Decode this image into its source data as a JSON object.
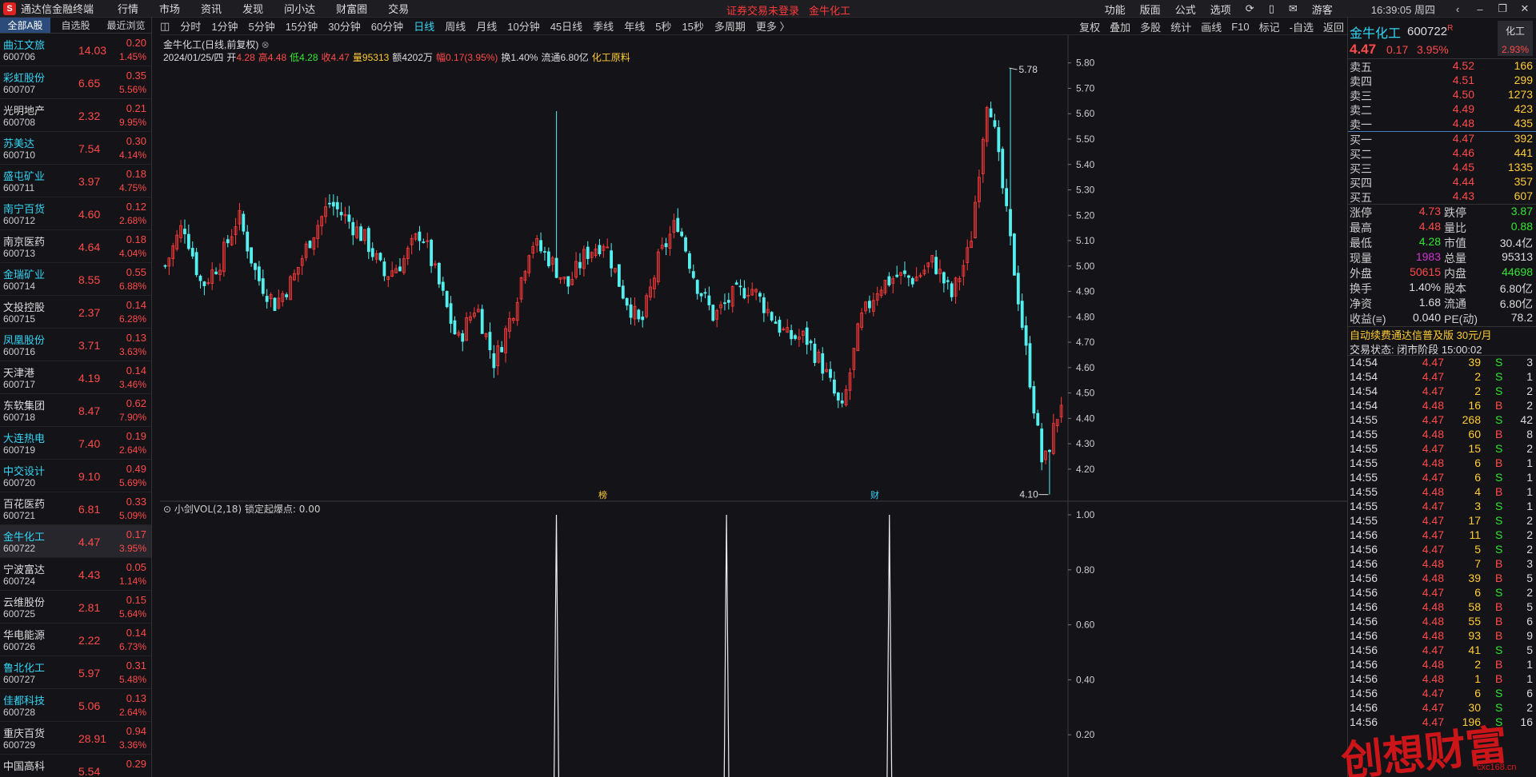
{
  "app": {
    "logo": "S",
    "title": "通达信金融终端",
    "menus": [
      "行情",
      "市场",
      "资讯",
      "发现",
      "问小达",
      "财富圈",
      "交易"
    ],
    "login_warning": "证券交易未登录",
    "current_stock_title": "金牛化工",
    "right_menus": [
      "功能",
      "版面",
      "公式",
      "选项"
    ],
    "user": "游客",
    "clock": "16:39:05 周四"
  },
  "left_tabs": [
    "全部A股",
    "自选股",
    "最近浏览"
  ],
  "stocks": [
    {
      "name": "曲江文旅",
      "code": "600706",
      "price": "14.03",
      "chg": "0.20",
      "pct": "1.45%",
      "color": "cyan"
    },
    {
      "name": "彩虹股份",
      "code": "600707",
      "price": "6.65",
      "chg": "0.35",
      "pct": "5.56%",
      "color": "cyan"
    },
    {
      "name": "光明地产",
      "code": "600708",
      "price": "2.32",
      "chg": "0.21",
      "pct": "9.95%",
      "color": "white"
    },
    {
      "name": "苏美达",
      "code": "600710",
      "price": "7.54",
      "chg": "0.30",
      "pct": "4.14%",
      "color": "cyan"
    },
    {
      "name": "盛屯矿业",
      "code": "600711",
      "price": "3.97",
      "chg": "0.18",
      "pct": "4.75%",
      "color": "cyan"
    },
    {
      "name": "南宁百货",
      "code": "600712",
      "price": "4.60",
      "chg": "0.12",
      "pct": "2.68%",
      "color": "cyan"
    },
    {
      "name": "南京医药",
      "code": "600713",
      "price": "4.64",
      "chg": "0.18",
      "pct": "4.04%",
      "color": "white"
    },
    {
      "name": "金瑞矿业",
      "code": "600714",
      "price": "8.55",
      "chg": "0.55",
      "pct": "6.88%",
      "color": "cyan"
    },
    {
      "name": "文投控股",
      "code": "600715",
      "price": "2.37",
      "chg": "0.14",
      "pct": "6.28%",
      "color": "white"
    },
    {
      "name": "凤凰股份",
      "code": "600716",
      "price": "3.71",
      "chg": "0.13",
      "pct": "3.63%",
      "color": "cyan"
    },
    {
      "name": "天津港",
      "code": "600717",
      "price": "4.19",
      "chg": "0.14",
      "pct": "3.46%",
      "color": "white"
    },
    {
      "name": "东软集团",
      "code": "600718",
      "price": "8.47",
      "chg": "0.62",
      "pct": "7.90%",
      "color": "white"
    },
    {
      "name": "大连热电",
      "code": "600719",
      "price": "7.40",
      "chg": "0.19",
      "pct": "2.64%",
      "color": "cyan"
    },
    {
      "name": "中交设计",
      "code": "600720",
      "price": "9.10",
      "chg": "0.49",
      "pct": "5.69%",
      "color": "cyan"
    },
    {
      "name": "百花医药",
      "code": "600721",
      "price": "6.81",
      "chg": "0.33",
      "pct": "5.09%",
      "color": "white"
    },
    {
      "name": "金牛化工",
      "code": "600722",
      "price": "4.47",
      "chg": "0.17",
      "pct": "3.95%",
      "color": "cyan"
    },
    {
      "name": "宁波富达",
      "code": "600724",
      "price": "4.43",
      "chg": "0.05",
      "pct": "1.14%",
      "color": "white"
    },
    {
      "name": "云维股份",
      "code": "600725",
      "price": "2.81",
      "chg": "0.15",
      "pct": "5.64%",
      "color": "white"
    },
    {
      "name": "华电能源",
      "code": "600726",
      "price": "2.22",
      "chg": "0.14",
      "pct": "6.73%",
      "color": "white"
    },
    {
      "name": "鲁北化工",
      "code": "600727",
      "price": "5.97",
      "chg": "0.31",
      "pct": "5.48%",
      "color": "cyan"
    },
    {
      "name": "佳都科技",
      "code": "600728",
      "price": "5.06",
      "chg": "0.13",
      "pct": "2.64%",
      "color": "cyan"
    },
    {
      "name": "重庆百货",
      "code": "600729",
      "price": "28.91",
      "chg": "0.94",
      "pct": "3.36%",
      "color": "white"
    },
    {
      "name": "中国高科",
      "code": "",
      "price": "5.54",
      "chg": "0.29",
      "pct": "",
      "color": "white"
    }
  ],
  "periods": [
    "分时",
    "1分钟",
    "5分钟",
    "15分钟",
    "30分钟",
    "60分钟",
    "日线",
    "周线",
    "月线",
    "10分钟",
    "45日线",
    "季线",
    "年线",
    "5秒",
    "15秒",
    "多周期",
    "更多 〉"
  ],
  "active_period": "日线",
  "tools": [
    "复权",
    "叠加",
    "多股",
    "统计",
    "画线",
    "F10",
    "标记",
    "-自选",
    "返回"
  ],
  "chart_header": {
    "title": "金牛化工(日线,前复权)",
    "date": "2024/01/25/四",
    "open_label": "开",
    "open": "4.28",
    "high_label": "高",
    "high": "4.48",
    "low_label": "低",
    "low": "4.28",
    "close_label": "收",
    "close": "4.47",
    "vol_label": "量",
    "vol": "95313",
    "amt_label": "额",
    "amt": "4202万",
    "chg_label": "幅",
    "chg": "0.17(3.95%)",
    "turnover": "换1.40%",
    "float": "流通6.80亿",
    "sector": "化工原料"
  },
  "indicator": {
    "name": "小剑VOL(2,18)",
    "label": "锁定起爆点:",
    "value": "0.00"
  },
  "markers": [
    "榜",
    "财"
  ],
  "chart_data": {
    "type": "candlestick",
    "ylim": [
      4.08,
      5.84
    ],
    "ticks": [
      "5.80",
      "5.70",
      "5.60",
      "5.50",
      "5.40",
      "5.30",
      "5.20",
      "5.10",
      "5.00",
      "4.90",
      "4.80",
      "4.70",
      "4.60",
      "4.50",
      "4.40",
      "4.30",
      "4.20"
    ],
    "max_label": "5.78",
    "min_label": "4.10",
    "max": 5.78,
    "min": 4.1,
    "close_keypoints": [
      5.0,
      5.17,
      4.92,
      5.02,
      5.2,
      4.96,
      4.85,
      4.95,
      5.12,
      5.25,
      5.18,
      5.1,
      4.96,
      5.02,
      5.14,
      4.92,
      4.7,
      4.85,
      4.62,
      4.82,
      5.1,
      5.03,
      4.92,
      5.05,
      5.1,
      4.9,
      4.76,
      5.03,
      5.18,
      4.94,
      4.8,
      4.88,
      4.92,
      4.82,
      4.72,
      4.72,
      4.6,
      4.42,
      4.78,
      4.92,
      4.96,
      4.95,
      5.02,
      4.88,
      5.07,
      5.7,
      5.2,
      4.7,
      4.2,
      4.47
    ],
    "vol_ticks": [
      "1.00",
      "0.80",
      "0.60",
      "0.40",
      "0.20"
    ],
    "vol_ylim": [
      0,
      1.0
    ],
    "spike_positions": [
      0.436,
      0.625,
      0.806
    ]
  },
  "quote": {
    "name": "金牛化工",
    "code": "600722",
    "r_mark": "R",
    "price": "4.47",
    "chg": "0.17",
    "pct": "3.95%",
    "industry": "化工",
    "industry_pct": "2.93%",
    "asks": [
      {
        "l": "卖五",
        "p": "4.52",
        "v": "166"
      },
      {
        "l": "卖四",
        "p": "4.51",
        "v": "299"
      },
      {
        "l": "卖三",
        "p": "4.50",
        "v": "1273"
      },
      {
        "l": "卖二",
        "p": "4.49",
        "v": "423"
      },
      {
        "l": "卖一",
        "p": "4.48",
        "v": "435"
      }
    ],
    "bids": [
      {
        "l": "买一",
        "p": "4.47",
        "v": "392"
      },
      {
        "l": "买二",
        "p": "4.46",
        "v": "441"
      },
      {
        "l": "买三",
        "p": "4.45",
        "v": "1335"
      },
      {
        "l": "买四",
        "p": "4.44",
        "v": "357"
      },
      {
        "l": "买五",
        "p": "4.43",
        "v": "607"
      }
    ],
    "stats": [
      {
        "l1": "涨停",
        "v1": "4.73",
        "c1": "r",
        "l2": "跌停",
        "v2": "3.87",
        "c2": "g"
      },
      {
        "l1": "最高",
        "v1": "4.48",
        "c1": "r",
        "l2": "量比",
        "v2": "0.88",
        "c2": "g"
      },
      {
        "l1": "最低",
        "v1": "4.28",
        "c1": "g",
        "l2": "市值",
        "v2": "30.4亿",
        "c2": "w"
      },
      {
        "l1": "现量",
        "v1": "1983",
        "c1": "m",
        "l2": "总量",
        "v2": "95313",
        "c2": "w"
      },
      {
        "l1": "外盘",
        "v1": "50615",
        "c1": "r",
        "l2": "内盘",
        "v2": "44698",
        "c2": "g"
      },
      {
        "l1": "换手",
        "v1": "1.40%",
        "c1": "w",
        "l2": "股本",
        "v2": "6.80亿",
        "c2": "w"
      },
      {
        "l1": "净资",
        "v1": "1.68",
        "c1": "w",
        "l2": "流通",
        "v2": "6.80亿",
        "c2": "w"
      },
      {
        "l1": "收益(≡)",
        "v1": "0.040",
        "c1": "w",
        "l2": "PE(动)",
        "v2": "78.2",
        "c2": "w"
      }
    ],
    "ad": "自动续费通达信普及版  30元/月",
    "trade_status": "交易状态: 闭市阶段 15:00:02",
    "ticks": [
      [
        "14:54",
        "4.47",
        "39",
        "S",
        "3"
      ],
      [
        "14:54",
        "4.47",
        "2",
        "S",
        "1"
      ],
      [
        "14:54",
        "4.47",
        "2",
        "S",
        "2"
      ],
      [
        "14:54",
        "4.48",
        "16",
        "B",
        "2"
      ],
      [
        "14:55",
        "4.47",
        "268",
        "S",
        "42"
      ],
      [
        "14:55",
        "4.48",
        "60",
        "B",
        "8"
      ],
      [
        "14:55",
        "4.47",
        "15",
        "S",
        "2"
      ],
      [
        "14:55",
        "4.48",
        "6",
        "B",
        "1"
      ],
      [
        "14:55",
        "4.47",
        "6",
        "S",
        "1"
      ],
      [
        "14:55",
        "4.48",
        "4",
        "B",
        "1"
      ],
      [
        "14:55",
        "4.47",
        "3",
        "S",
        "1"
      ],
      [
        "14:55",
        "4.47",
        "17",
        "S",
        "2"
      ],
      [
        "14:56",
        "4.47",
        "11",
        "S",
        "2"
      ],
      [
        "14:56",
        "4.47",
        "5",
        "S",
        "2"
      ],
      [
        "14:56",
        "4.48",
        "7",
        "B",
        "3"
      ],
      [
        "14:56",
        "4.48",
        "39",
        "B",
        "5"
      ],
      [
        "14:56",
        "4.47",
        "6",
        "S",
        "2"
      ],
      [
        "14:56",
        "4.48",
        "58",
        "B",
        "5"
      ],
      [
        "14:56",
        "4.48",
        "55",
        "B",
        "6"
      ],
      [
        "14:56",
        "4.48",
        "93",
        "B",
        "9"
      ],
      [
        "14:56",
        "4.47",
        "41",
        "S",
        "5"
      ],
      [
        "14:56",
        "4.48",
        "2",
        "B",
        "1"
      ],
      [
        "14:56",
        "4.48",
        "1",
        "B",
        "1"
      ],
      [
        "14:56",
        "4.47",
        "6",
        "S",
        "6"
      ],
      [
        "14:56",
        "4.47",
        "30",
        "S",
        "2"
      ],
      [
        "14:56",
        "4.47",
        "196",
        "S",
        "16"
      ]
    ]
  },
  "watermark": {
    "text": "创想财富",
    "url": "cxc168.cn"
  }
}
